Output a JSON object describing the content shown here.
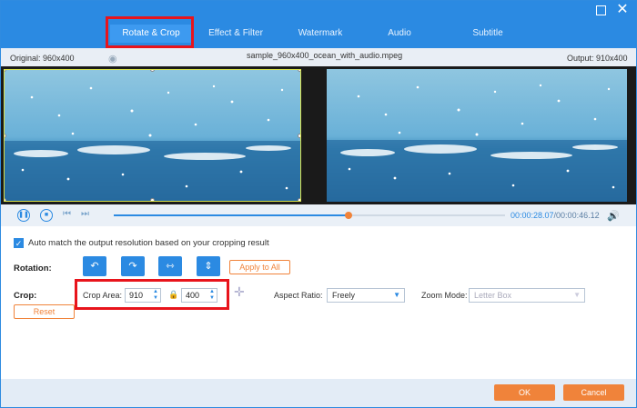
{
  "tabs": [
    {
      "label": "Rotate & Crop",
      "active": true
    },
    {
      "label": "Effect & Filter",
      "active": false
    },
    {
      "label": "Watermark",
      "active": false
    },
    {
      "label": "Audio",
      "active": false
    },
    {
      "label": "Subtitle",
      "active": false
    }
  ],
  "window": {
    "maximize_icon": "maximize-icon",
    "close_icon": "close-icon"
  },
  "info": {
    "original": "Original: 960x400",
    "filename": "sample_960x400_ocean_with_audio.mpeg",
    "output": "Output: 910x400"
  },
  "playback": {
    "current_time": "00:00:28.07",
    "total_time": "/00:00:46.12",
    "progress_fraction": 0.6
  },
  "options": {
    "auto_match_label": "Auto match the output resolution based on your cropping result",
    "auto_match_checked": true,
    "rotation_label": "Rotation:",
    "apply_all_label": "Apply to All",
    "crop_label": "Crop:",
    "reset_label": "Reset",
    "crop_area_label": "Crop Area:",
    "crop_width": "910",
    "crop_height": "400",
    "aspect_label": "Aspect Ratio:",
    "aspect_value": "Freely",
    "zoom_label": "Zoom Mode:",
    "zoom_value": "Letter Box"
  },
  "footer": {
    "ok_label": "OK",
    "cancel_label": "Cancel"
  },
  "colors": {
    "accent": "#2b8ae2",
    "orange": "#f0833a",
    "highlight": "#e8141c"
  }
}
